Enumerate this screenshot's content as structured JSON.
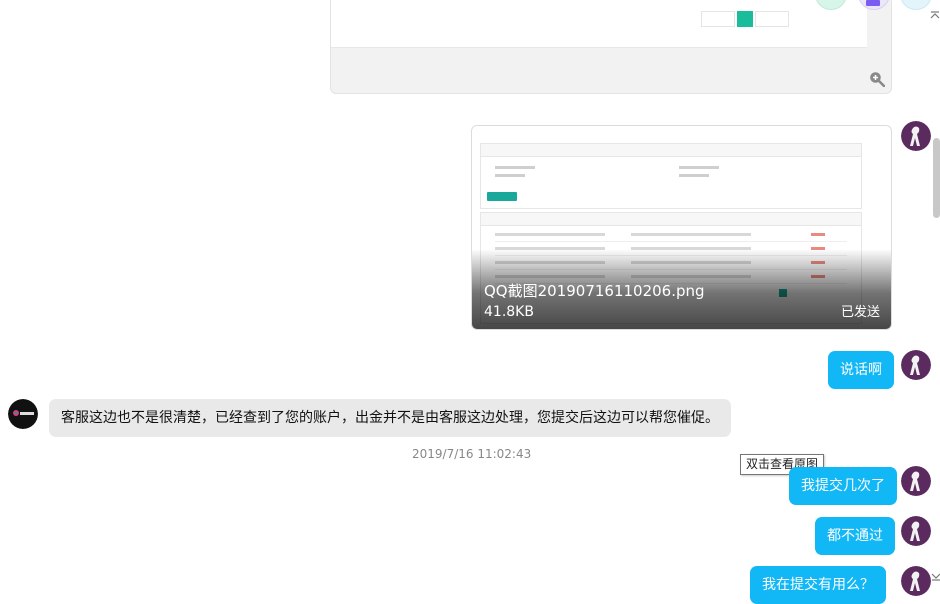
{
  "image_message": {
    "file_name": "QQ截图20190716110206.png",
    "file_size": "41.8KB",
    "status": "已发送"
  },
  "messages": [
    {
      "id": "m1",
      "text": "说话啊"
    },
    {
      "id": "m2",
      "text": "客服这边也不是很清楚，已经查到了您的账户，出金并不是由客服这边处理，您提交后这边可以帮您催促。"
    },
    {
      "id": "m3",
      "text": "我提交几次了"
    },
    {
      "id": "m4",
      "text": "都不通过"
    },
    {
      "id": "m5",
      "text": "我在提交有用么？"
    }
  ],
  "timestamp": "2019/7/16 11:02:43",
  "tooltip": "双击查看原图",
  "icons": {
    "zoom": "zoom-in-icon",
    "collapse": "collapse-icon",
    "scroll_down": "scroll-down-icon"
  },
  "colors": {
    "bubble_out": "#12b7f5",
    "bubble_in": "#e9e9e9",
    "accent": "#1aa89a"
  }
}
